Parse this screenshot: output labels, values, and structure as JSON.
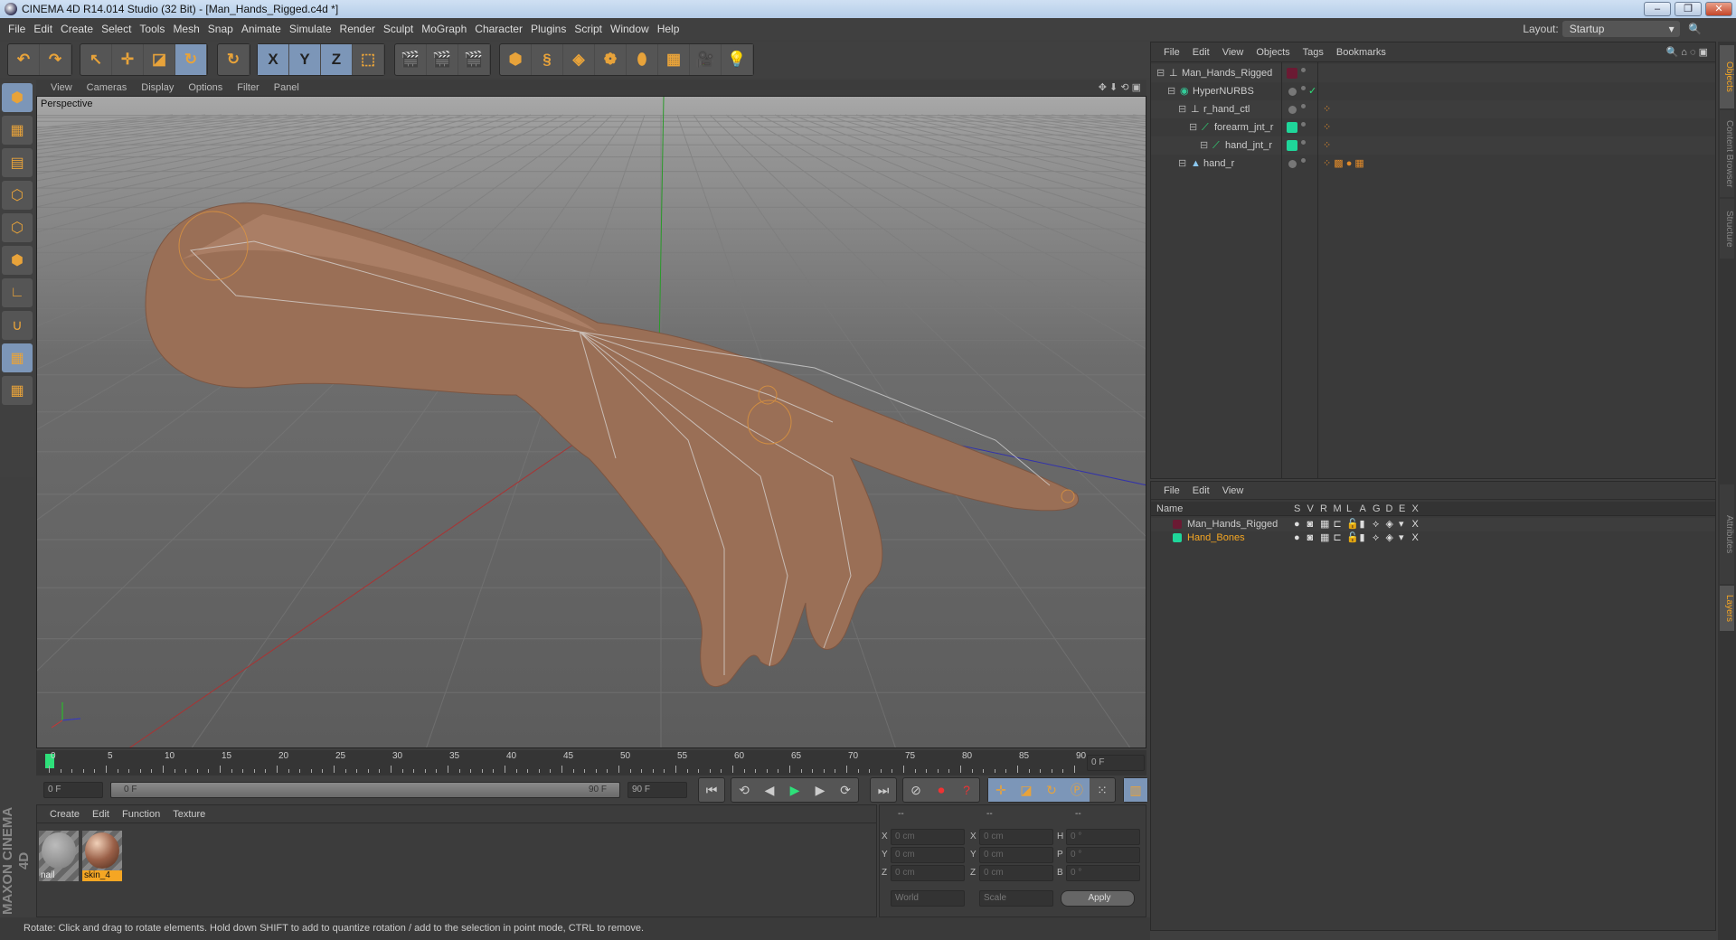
{
  "window": {
    "title": "CINEMA 4D R14.014 Studio (32 Bit) - [Man_Hands_Rigged.c4d *]",
    "min": "–",
    "restore": "❐",
    "close": "✕"
  },
  "menu": [
    "File",
    "Edit",
    "Create",
    "Select",
    "Tools",
    "Mesh",
    "Snap",
    "Animate",
    "Simulate",
    "Render",
    "Sculpt",
    "MoGraph",
    "Character",
    "Plugins",
    "Script",
    "Window",
    "Help"
  ],
  "layout": {
    "label": "Layout:",
    "value": "Startup"
  },
  "toolbar_groups": [
    [
      {
        "icon": "undo-icon",
        "g": "↶"
      },
      {
        "icon": "redo-icon",
        "g": "↷"
      }
    ],
    [
      {
        "icon": "select-arrow-icon",
        "g": "↖"
      },
      {
        "icon": "move-icon",
        "g": "✛"
      },
      {
        "icon": "scale-icon",
        "g": "◪"
      },
      {
        "icon": "rotate-icon",
        "g": "↻",
        "on": true
      }
    ],
    [
      {
        "icon": "recent-tool-icon",
        "g": "↻"
      }
    ],
    [
      {
        "icon": "x-axis-icon",
        "g": "X",
        "on": true
      },
      {
        "icon": "y-axis-icon",
        "g": "Y",
        "on": true
      },
      {
        "icon": "z-axis-icon",
        "g": "Z",
        "on": true
      },
      {
        "icon": "coordinate-system-icon",
        "g": "⬚"
      }
    ],
    [
      {
        "icon": "render-view-icon",
        "g": "🎬"
      },
      {
        "icon": "render-picture-viewer-icon",
        "g": "🎬"
      },
      {
        "icon": "render-settings-icon",
        "g": "🎬"
      }
    ],
    [
      {
        "icon": "cube-icon",
        "g": "⬢"
      },
      {
        "icon": "spline-icon",
        "g": "§"
      },
      {
        "icon": "nurbs-icon",
        "g": "◈"
      },
      {
        "icon": "mograph-cloner-icon",
        "g": "❁"
      },
      {
        "icon": "deformer-icon",
        "g": "⬮"
      },
      {
        "icon": "floor-icon",
        "g": "▦"
      },
      {
        "icon": "camera-icon",
        "g": "🎥"
      },
      {
        "icon": "light-icon",
        "g": "💡"
      }
    ]
  ],
  "left_tools": [
    {
      "icon": "model-mode-icon",
      "g": "⬢",
      "on": true
    },
    {
      "icon": "texture-mode-icon",
      "g": "▦"
    },
    {
      "icon": "workplane-icon",
      "g": "▤"
    },
    {
      "icon": "points-mode-icon",
      "g": "⬡"
    },
    {
      "icon": "edges-mode-icon",
      "g": "⬡"
    },
    {
      "icon": "polygons-mode-icon",
      "g": "⬢"
    },
    {
      "icon": "axis-mode-icon",
      "g": "∟"
    },
    {
      "icon": "magnet-icon",
      "g": "∪"
    },
    {
      "icon": "snap-grid-icon",
      "g": "▦",
      "on": true
    },
    {
      "icon": "lock-workplane-icon",
      "g": "▦"
    }
  ],
  "viewport": {
    "menu": [
      "View",
      "Cameras",
      "Display",
      "Options",
      "Filter",
      "Panel"
    ],
    "label": "Perspective"
  },
  "timeline": {
    "ticks": [
      0,
      5,
      10,
      15,
      20,
      25,
      30,
      35,
      40,
      45,
      50,
      55,
      60,
      65,
      70,
      75,
      80,
      85,
      90
    ],
    "current": "0 F",
    "start": "0 F",
    "range_start": "0 F",
    "range_end": "90 F",
    "end": "90 F"
  },
  "materials": {
    "menu": [
      "Create",
      "Edit",
      "Function",
      "Texture"
    ],
    "items": [
      {
        "name": "nail",
        "selected": false
      },
      {
        "name": "skin_4",
        "selected": true
      }
    ]
  },
  "coords": {
    "headers": [
      "--",
      "--",
      "--"
    ],
    "rows": [
      {
        "a": "X",
        "av": "0 cm",
        "b": "X",
        "bv": "0 cm",
        "c": "H",
        "cv": "0 °"
      },
      {
        "a": "Y",
        "av": "0 cm",
        "b": "Y",
        "bv": "0 cm",
        "c": "P",
        "cv": "0 °"
      },
      {
        "a": "Z",
        "av": "0 cm",
        "b": "Z",
        "bv": "0 cm",
        "c": "B",
        "cv": "0 °"
      }
    ],
    "world": "World",
    "scale": "Scale",
    "apply": "Apply"
  },
  "status": "Rotate: Click and drag to rotate elements. Hold down SHIFT to add to quantize rotation / add to the selection in point mode, CTRL to remove.",
  "maxon": "MAXON CINEMA 4D",
  "objects": {
    "menu": [
      "File",
      "Edit",
      "View",
      "Objects",
      "Tags",
      "Bookmarks"
    ],
    "items": [
      {
        "name": "Man_Hands_Rigged",
        "indent": 0,
        "icon": "null-icon",
        "color": "#6b1a33",
        "tags": ""
      },
      {
        "name": "HyperNURBS",
        "indent": 1,
        "icon": "hypernurbs-icon",
        "color": "",
        "tags": "",
        "check": "✓"
      },
      {
        "name": "r_hand_ctl",
        "indent": 2,
        "icon": "null-icon",
        "color": "",
        "tags": "⁘"
      },
      {
        "name": "forearm_jnt_r",
        "indent": 3,
        "icon": "joint-icon",
        "color": "#1fd69a",
        "tags": "⁘"
      },
      {
        "name": "hand_jnt_r",
        "indent": 4,
        "icon": "joint-icon",
        "color": "#1fd69a",
        "tags": "⁘"
      },
      {
        "name": "hand_r",
        "indent": 2,
        "icon": "polygon-object-icon",
        "color": "",
        "tags": "⁘ ▩ ● ▦"
      }
    ]
  },
  "layers": {
    "menu": [
      "File",
      "Edit",
      "View"
    ],
    "columns": [
      "Name",
      "S",
      "V",
      "R",
      "M",
      "L",
      "A",
      "G",
      "D",
      "E",
      "X"
    ],
    "items": [
      {
        "name": "Man_Hands_Rigged",
        "color": "#6b1a33",
        "active": false
      },
      {
        "name": "Hand_Bones",
        "color": "#1fd69a",
        "active": true
      }
    ]
  },
  "side_tabs": [
    "Objects",
    "Content Browser",
    "Structure",
    "Attributes",
    "Layers"
  ],
  "colors": {
    "accent": "#f5a623",
    "highlight": "#7c96b8",
    "play": "#2ee07a"
  }
}
